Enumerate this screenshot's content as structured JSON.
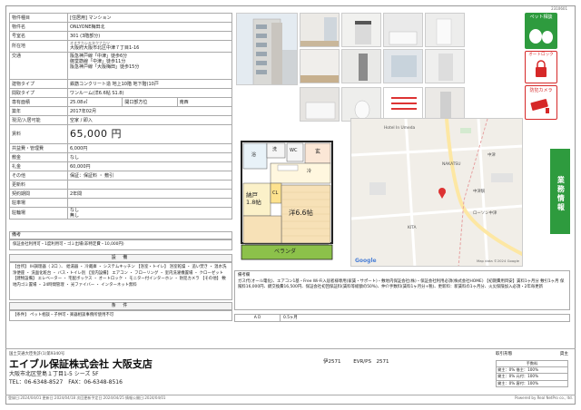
{
  "doc_number": "2310601",
  "property": {
    "type_label": "物件種目",
    "type_value": "[住居用] マンション",
    "name_label": "物件名",
    "name_value": "ONLYONE梅田北",
    "room_label": "号室名",
    "room_value": "301 (3階部分)",
    "address_label": "所在地",
    "address_kana": "オオサカシキタクナカツ",
    "address_value": "大阪府大阪市北区中津７丁目1-16",
    "traffic_label": "交通",
    "traffic_lines": [
      "阪急神戸線「中津」徒歩6分",
      "御堂筋線「中津」徒歩11分",
      "阪急神戸線「大阪梅田」徒歩15分"
    ],
    "structure_label": "建物タイプ",
    "structure_value": "鉄筋コンクリート造 地上10階 地下階(10戸",
    "layout_label": "間取タイプ",
    "layout_value": "ワンルーム(洋6.6帖 S1.8)",
    "area_label": "専有面積",
    "area_value": "25.08㎡",
    "exposure_label": "開口部方位",
    "exposure_value": "南西",
    "built_label": "築年",
    "built_value": "2017年02月",
    "movein_label": "現況/入居可能",
    "movein_value": "空家 / 即入",
    "rent_label": "賃料",
    "rent_value": "65,000 円",
    "mgmt_label": "共益費・管理費",
    "mgmt_value": "6,000円",
    "deposit_label": "敷金",
    "deposit_value": "なし",
    "key_label": "礼金",
    "key_value": "60,000円",
    "other_label": "その他",
    "other_value": "保証：保証料 ・ 敷引",
    "renewal_label": "更新料",
    "renewal_value": "",
    "contract_label": "契約期間",
    "contract_value": "2年間",
    "parking_label": "駐車場",
    "parking_value": "",
    "bike_label": "駐輪場",
    "bike_value": "なし",
    "bike_value2": "無し"
  },
  "memo": {
    "label": "備考",
    "text": "保証会社利用可・1度利用可・ゴミ出場(非特定費・10,000円)"
  },
  "equipment": {
    "title": "設 備",
    "text": "【台所】 IH調理器（ 2口 ）、 給湯器 ・ 冷蔵庫 ・ システムキッチン 【浴室・トイレ】 浴室乾燥 ・ 追い焚き ・ 温水洗浄便座 ・ 洗面化粧台 ・ バス・トイレ別 【室内設備】 エアコン ・ フローリング ・ 室内洗濯機置場 ・ クローゼット 【建物設備】 エレベーター ・ 宅配ボックス ・ オートロック ・ モニター付インターホン ・ 防犯カメラ 【その他】 敷地内ゴミ置場 ・ 24時間管理 ・ 光ファイバー ・ インターネット無料"
  },
  "conditions": {
    "title": "条 件",
    "text": "【条件】 ペット相談・子供可・楽器相談事務所使用不可"
  },
  "floorplan": {
    "entrance": "玄",
    "storage": "納戸\n1.8帖",
    "room": "洋6.6帖",
    "veranda": "ベランダ",
    "bath": "浴",
    "laundry": "洗",
    "wc": "WC",
    "fridge": "冷",
    "cl": "CL"
  },
  "map": {
    "copyright": "Map data ©2024 Google",
    "places": [
      "Hotel In Umeda",
      "中津",
      "NAKATSU",
      "中津駅",
      "KITA",
      "ローソン中津"
    ]
  },
  "badges": {
    "pet": "ペット相談",
    "autolock": "オートロック",
    "camera": "防犯カメラ",
    "side": "業務情報"
  },
  "remarks": {
    "title": "備考欄",
    "text": "ガス代(オール電化)、エアコン1基・Free Wi-Fi入居者様専用(家賃・サポート)・敷地内保証会社(株)・保証会社利用必須(株式会社HOME) 【初期費用目安】賃料1ヶ月分 敷引1ヶ月 保険料16,000円、鍵交換費16,500円、保証会社初回保証料(賃料等総額の50%)、仲介手数料(賃料1ヶ月分+税)、更新料：新賃料の1ヶ月分、火災保険加入必須・2年毎更新"
  },
  "ad": {
    "label": "ＡＤ",
    "value": "0.5ヶ月"
  },
  "footer": {
    "license": "国土交通大臣免許(1)第9340号",
    "company": "エイブル保証株式会社 大阪支店",
    "address": "大阪市北区堂島１丁目1-5 シーズ 5F",
    "tel": "TEL：06-6348-8527　FAX：06-6348-8516",
    "code1": "伊2571",
    "code2": "EVR/PS　2571",
    "fee_title": "取引形態",
    "fee_type": "貸主",
    "fee_header": "手数料",
    "fee_rows": [
      "貸主：0%  借主：100%",
      "貸主：0%  元付：100%",
      "貸主：0%  客付：100%"
    ],
    "printed": "登録日:2024/04/01  更新日:2024/04/18  次回更新予定日:2024/04/25  情報公開日:2024/04/01",
    "powered": "Powered by Real NetPro co., ltd."
  }
}
